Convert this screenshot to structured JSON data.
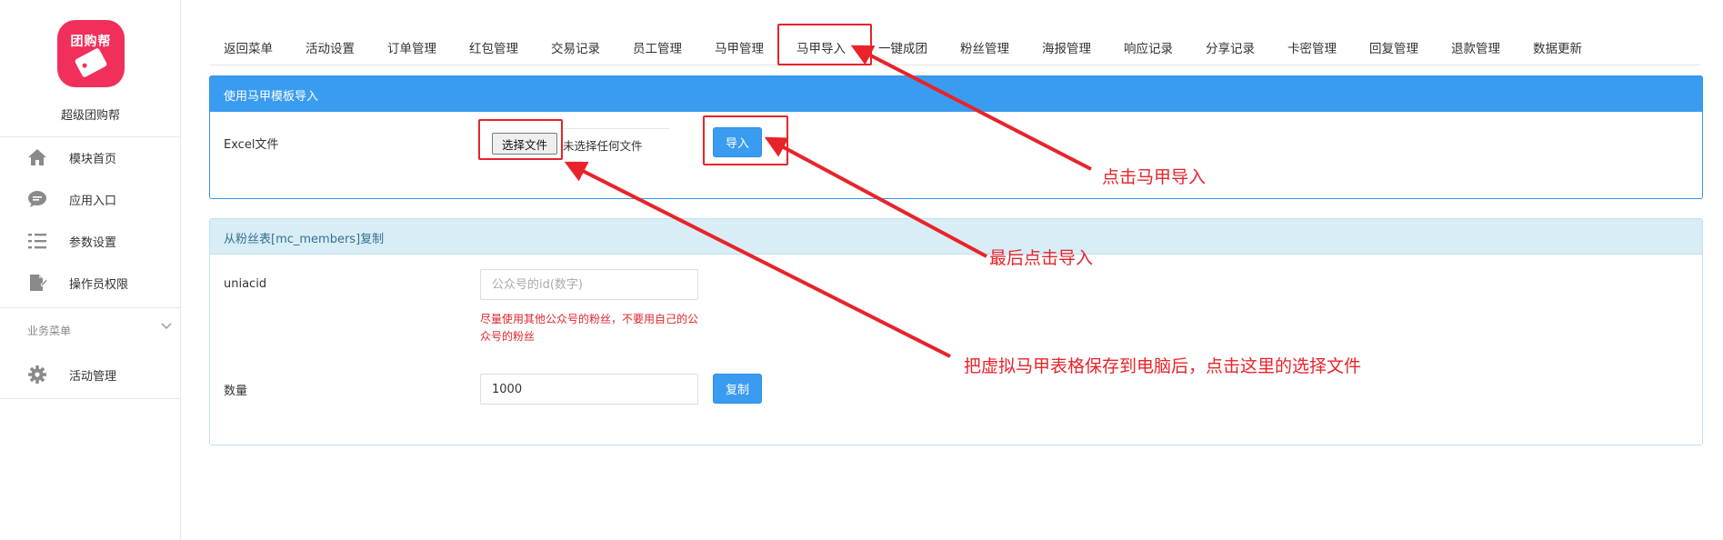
{
  "sidebar": {
    "logo_text": "团购帮",
    "app_name": "超级团购帮",
    "items": [
      {
        "label": "模块首页",
        "icon": "home-icon"
      },
      {
        "label": "应用入口",
        "icon": "chat-bubble-icon"
      },
      {
        "label": "参数设置",
        "icon": "list-settings-icon"
      },
      {
        "label": "操作员权限",
        "icon": "document-edit-icon"
      }
    ],
    "group_label": "业务菜单",
    "group_items": [
      {
        "label": "活动管理",
        "icon": "gear-icon"
      }
    ]
  },
  "tabs": [
    "返回菜单",
    "活动设置",
    "订单管理",
    "红包管理",
    "交易记录",
    "员工管理",
    "马甲管理",
    "马甲导入",
    "一键成团",
    "粉丝管理",
    "海报管理",
    "响应记录",
    "分享记录",
    "卡密管理",
    "回复管理",
    "退款管理",
    "数据更新"
  ],
  "active_tab": "马甲导入",
  "import_panel": {
    "title": "使用马甲模板导入",
    "excel_label": "Excel文件",
    "choose_file_label": "选择文件",
    "file_status": "未选择任何文件",
    "import_button": "导入"
  },
  "copy_panel": {
    "title": "从粉丝表[mc_members]复制",
    "uniacid_label": "uniacid",
    "uniacid_placeholder": "公众号的id(数字)",
    "uniacid_help": "尽量使用其他公众号的粉丝，不要用自己的公众号的粉丝",
    "quantity_label": "数量",
    "quantity_value": "1000",
    "copy_button": "复制"
  },
  "annotations": {
    "click_tab": "点击马甲导入",
    "click_import": "最后点击导入",
    "choose_file": "把虚拟马甲表格保存到电脑后，点击这里的选择文件"
  },
  "colors": {
    "primary": "#3a9cf0",
    "annotation_red": "#e8232a",
    "logo_pink": "#f0305a",
    "help_red": "#e0262d",
    "info_header": "#d9edf7"
  }
}
